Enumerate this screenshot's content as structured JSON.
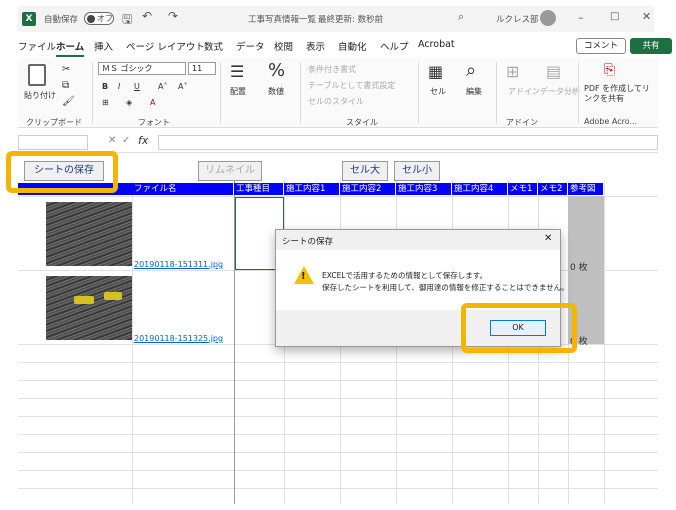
{
  "titlebar": {
    "autosave_label": "自動保存",
    "autosave_state": "オフ",
    "file_name": "工事写真情報一覧",
    "save_state": "最終更新: 数秒前",
    "user_name": "ルクレス部"
  },
  "menu": {
    "tabs": [
      "ファイル",
      "ホーム",
      "挿入",
      "ページ レイアウト",
      "数式",
      "データ",
      "校閲",
      "表示",
      "自動化",
      "ヘルプ",
      "Acrobat"
    ],
    "comment_label": "コメント",
    "share_label": "共有"
  },
  "ribbon": {
    "paste_label": "貼り付け",
    "font_name": "ＭＳ ゴシック",
    "font_size": "11",
    "align_label": "配置",
    "number_label": "数値",
    "conditional_format": "条件付き書式",
    "table_format": "テーブルとして書式設定",
    "cell_styles": "セルのスタイル",
    "cells_label": "セル",
    "edit_label": "編集",
    "addin_label": "アドイン",
    "analysis_label": "データ分析",
    "pdf_label": "PDF を作成してリンクを共有",
    "groups": [
      "クリップボード",
      "フォント",
      "スタイル",
      "アドイン",
      "Adobe Acro..."
    ]
  },
  "formula": {
    "fx": "fx"
  },
  "sheet": {
    "buttons": {
      "save": "シートの保存",
      "rename": "リムネイル",
      "cell_big": "セル大",
      "cell_small": "セル小"
    },
    "headers": [
      "ファイル名",
      "工事種目",
      "施工内容1",
      "施工内容2",
      "施工内容3",
      "施工内容4",
      "メモ1",
      "メモ2",
      "参考図"
    ],
    "rows": [
      {
        "file": "20190118-151311.jpg",
        "ref": "0 枚"
      },
      {
        "file": "20190118-151325.jpg",
        "ref": "0 枚"
      }
    ]
  },
  "dialog": {
    "title": "シートの保存",
    "message_line1": "EXCELで活用するための情報として保存します。",
    "message_line2": "保存したシートを利用して、御用達の情報を修正することはできません。",
    "ok_label": "OK"
  },
  "colors": {
    "excel_green": "#1d6f42",
    "header_blue": "#0000ff",
    "highlight_orange": "#f5b400"
  }
}
